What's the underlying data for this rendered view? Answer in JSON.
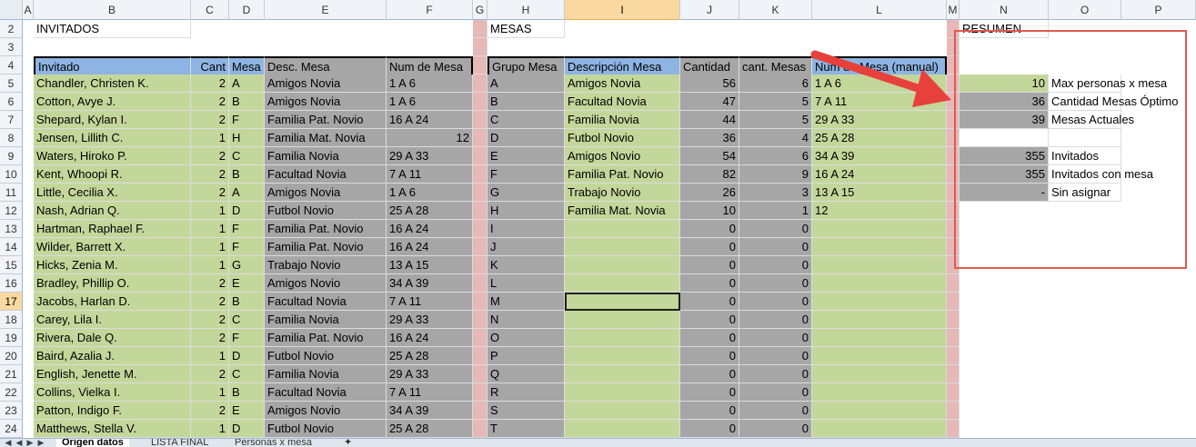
{
  "columns": [
    "A",
    "B",
    "C",
    "D",
    "E",
    "F",
    "G",
    "H",
    "I",
    "J",
    "K",
    "L",
    "M",
    "N",
    "O",
    "P"
  ],
  "rows": [
    2,
    3,
    4,
    5,
    6,
    7,
    8,
    9,
    10,
    11,
    12,
    13,
    14,
    15,
    16,
    17,
    18,
    19,
    20,
    21,
    22,
    23,
    24
  ],
  "selected_column": "I",
  "selected_row": 17,
  "titles": {
    "invitados": "INVITADOS",
    "mesas": "MESAS",
    "resumen": "RESUMEN"
  },
  "headers": {
    "invitado": "Invitado",
    "cant": "Cant",
    "mesa": "Mesa",
    "desc_mesa": "Desc. Mesa",
    "num_mesa": "Num de Mesa",
    "grupo_mesa": "Grupo Mesa",
    "descripcion_mesa": "Descripción Mesa",
    "cantidad": "Cantidad",
    "cant_mesas": "cant. Mesas",
    "num_mesa_manual": "Num de Mesa (manual)"
  },
  "guests": [
    {
      "name": "Chandler, Christen K.",
      "cant": "2",
      "mesa": "A",
      "desc": "Amigos Novia",
      "num": "1 A 6"
    },
    {
      "name": "Cotton, Avye J.",
      "cant": "2",
      "mesa": "B",
      "desc": "Amigos Novia",
      "num": "1 A 6"
    },
    {
      "name": "Shepard, Kylan I.",
      "cant": "2",
      "mesa": "F",
      "desc": "Familia Pat. Novio",
      "num": "16 A 24"
    },
    {
      "name": "Jensen, Lillith C.",
      "cant": "1",
      "mesa": "H",
      "desc": "Familia Mat. Novia",
      "num": "12"
    },
    {
      "name": "Waters, Hiroko P.",
      "cant": "2",
      "mesa": "C",
      "desc": "Familia Novia",
      "num": "29 A 33"
    },
    {
      "name": "Kent, Whoopi R.",
      "cant": "2",
      "mesa": "B",
      "desc": "Facultad  Novia",
      "num": "7 A 11"
    },
    {
      "name": "Little, Cecilia X.",
      "cant": "2",
      "mesa": "A",
      "desc": "Amigos Novia",
      "num": "1 A 6"
    },
    {
      "name": "Nash, Adrian Q.",
      "cant": "1",
      "mesa": "D",
      "desc": "Futbol Novio",
      "num": "25 A 28"
    },
    {
      "name": "Hartman, Raphael F.",
      "cant": "1",
      "mesa": "F",
      "desc": "Familia Pat. Novio",
      "num": "16 A 24"
    },
    {
      "name": "Wilder, Barrett X.",
      "cant": "1",
      "mesa": "F",
      "desc": "Familia Pat. Novio",
      "num": "16 A 24"
    },
    {
      "name": "Hicks, Zenia M.",
      "cant": "1",
      "mesa": "G",
      "desc": "Trabajo Novio",
      "num": "13 A 15"
    },
    {
      "name": "Bradley, Phillip O.",
      "cant": "2",
      "mesa": "E",
      "desc": "Amigos Novio",
      "num": "34 A 39"
    },
    {
      "name": "Jacobs, Harlan D.",
      "cant": "2",
      "mesa": "B",
      "desc": "Facultad  Novia",
      "num": "7 A 11"
    },
    {
      "name": "Carey, Lila I.",
      "cant": "2",
      "mesa": "C",
      "desc": "Familia Novia",
      "num": "29 A 33"
    },
    {
      "name": "Rivera, Dale Q.",
      "cant": "2",
      "mesa": "F",
      "desc": "Familia Pat. Novio",
      "num": "16 A 24"
    },
    {
      "name": "Baird, Azalia J.",
      "cant": "1",
      "mesa": "D",
      "desc": "Futbol Novio",
      "num": "25 A 28"
    },
    {
      "name": "English, Jenette M.",
      "cant": "2",
      "mesa": "C",
      "desc": "Familia Novia",
      "num": "29 A 33"
    },
    {
      "name": "Collins, Vielka I.",
      "cant": "1",
      "mesa": "B",
      "desc": "Facultad  Novia",
      "num": "7 A 11"
    },
    {
      "name": "Patton, Indigo F.",
      "cant": "2",
      "mesa": "E",
      "desc": "Amigos Novio",
      "num": "34 A 39"
    },
    {
      "name": "Matthews, Stella V.",
      "cant": "1",
      "mesa": "D",
      "desc": "Futbol Novio",
      "num": "25 A 28"
    }
  ],
  "tables": [
    {
      "grupo": "A",
      "desc": "Amigos Novia",
      "cantidad": "56",
      "mesas": "6",
      "manual": "1 A 6"
    },
    {
      "grupo": "B",
      "desc": "Facultad  Novia",
      "cantidad": "47",
      "mesas": "5",
      "manual": "7 A 11"
    },
    {
      "grupo": "C",
      "desc": "Familia Novia",
      "cantidad": "44",
      "mesas": "5",
      "manual": "29 A 33"
    },
    {
      "grupo": "D",
      "desc": "Futbol Novio",
      "cantidad": "36",
      "mesas": "4",
      "manual": "25 A 28"
    },
    {
      "grupo": "E",
      "desc": "Amigos Novio",
      "cantidad": "54",
      "mesas": "6",
      "manual": "34 A 39"
    },
    {
      "grupo": "F",
      "desc": "Familia Pat. Novio",
      "cantidad": "82",
      "mesas": "9",
      "manual": "16 A 24"
    },
    {
      "grupo": "G",
      "desc": "Trabajo Novio",
      "cantidad": "26",
      "mesas": "3",
      "manual": "13 A 15"
    },
    {
      "grupo": "H",
      "desc": "Familia Mat. Novia",
      "cantidad": "10",
      "mesas": "1",
      "manual": "12"
    },
    {
      "grupo": "I",
      "desc": "",
      "cantidad": "0",
      "mesas": "0",
      "manual": ""
    },
    {
      "grupo": "J",
      "desc": "",
      "cantidad": "0",
      "mesas": "0",
      "manual": ""
    },
    {
      "grupo": "K",
      "desc": "",
      "cantidad": "0",
      "mesas": "0",
      "manual": ""
    },
    {
      "grupo": "L",
      "desc": "",
      "cantidad": "0",
      "mesas": "0",
      "manual": ""
    },
    {
      "grupo": "M",
      "desc": "",
      "cantidad": "0",
      "mesas": "0",
      "manual": ""
    },
    {
      "grupo": "N",
      "desc": "",
      "cantidad": "0",
      "mesas": "0",
      "manual": ""
    },
    {
      "grupo": "O",
      "desc": "",
      "cantidad": "0",
      "mesas": "0",
      "manual": ""
    },
    {
      "grupo": "P",
      "desc": "",
      "cantidad": "0",
      "mesas": "0",
      "manual": ""
    },
    {
      "grupo": "Q",
      "desc": "",
      "cantidad": "0",
      "mesas": "0",
      "manual": ""
    },
    {
      "grupo": "R",
      "desc": "",
      "cantidad": "0",
      "mesas": "0",
      "manual": ""
    },
    {
      "grupo": "S",
      "desc": "",
      "cantidad": "0",
      "mesas": "0",
      "manual": ""
    },
    {
      "grupo": "T",
      "desc": "",
      "cantidad": "0",
      "mesas": "0",
      "manual": ""
    }
  ],
  "summary": [
    {
      "value": "10",
      "label": "Max personas x mesa",
      "bg": "green"
    },
    {
      "value": "36",
      "label": "Cantidad Mesas Óptimo",
      "bg": "gray"
    },
    {
      "value": "39",
      "label": "Mesas Actuales",
      "bg": "gray"
    },
    {
      "value": "",
      "label": "",
      "bg": "none"
    },
    {
      "value": "355",
      "label": "Invitados",
      "bg": "gray"
    },
    {
      "value": "355",
      "label": "Invitados con mesa",
      "bg": "gray"
    },
    {
      "value": "-",
      "label": "Sin asignar",
      "bg": "gray"
    }
  ],
  "sheet_tabs": [
    "Origen datos",
    "LISTA FINAL",
    "Personas x mesa"
  ],
  "active_tab": "Origen datos",
  "colors": {
    "green": "#c4d79b",
    "gray": "#a6a6a6",
    "blue": "#8db4e2",
    "pink": "#e6b8b7",
    "highlight_red": "#e05a4e",
    "arrow_red": "#e8403a"
  }
}
